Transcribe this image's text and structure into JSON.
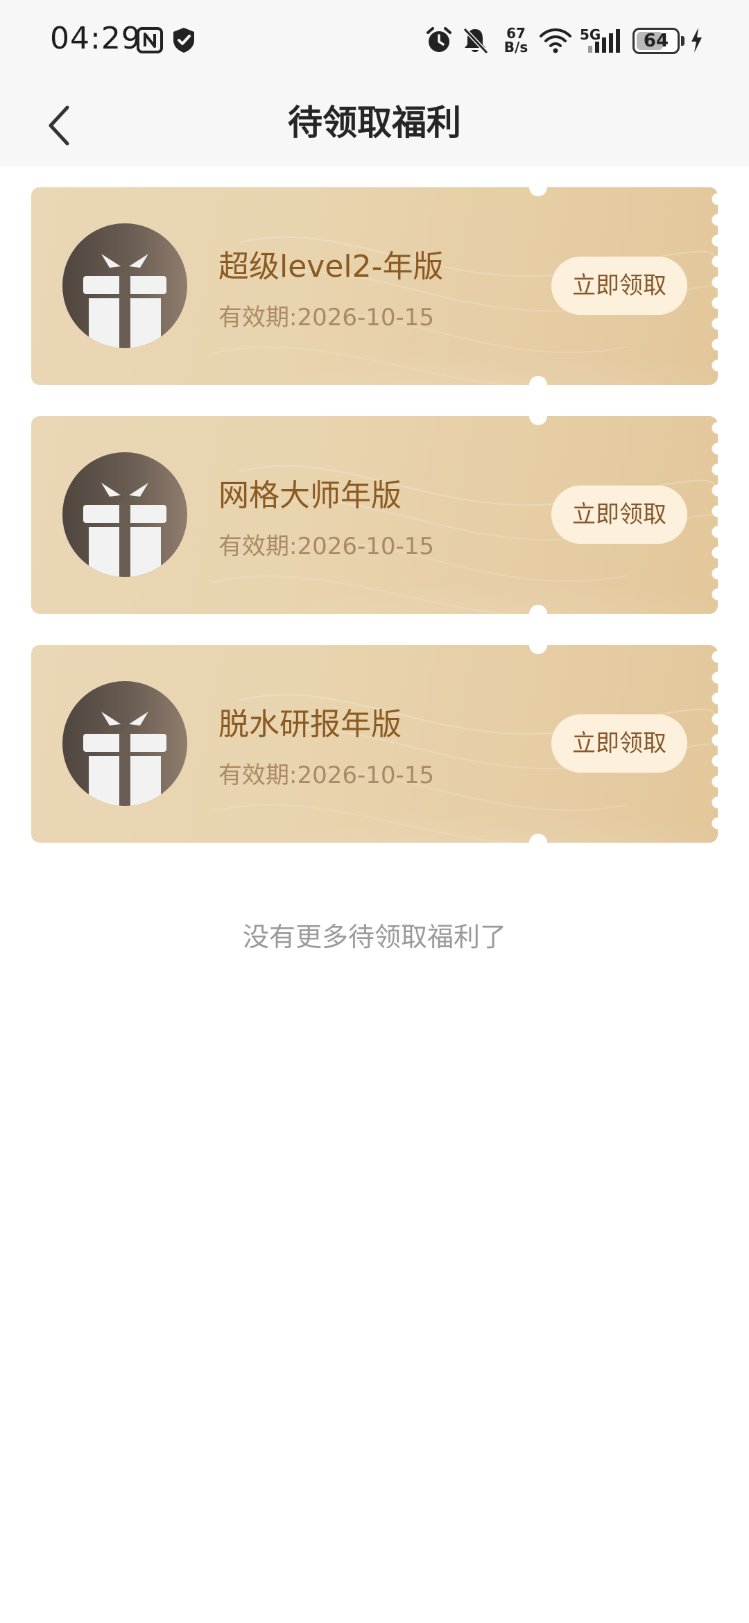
{
  "status_bar": {
    "time": "04:29",
    "net_speed_value": "67",
    "net_speed_unit": "B/s",
    "network_type": "5G",
    "battery_level": "64",
    "icons": [
      "nfc-icon",
      "shield-check-icon",
      "alarm-icon",
      "bell-off-icon",
      "wifi-icon",
      "signal-icon",
      "charging-icon"
    ]
  },
  "nav": {
    "title": "待领取福利",
    "back_icon": "chevron-left-icon"
  },
  "coupons": [
    {
      "title": "超级level2-年版",
      "expiry": "有效期:2026-10-15",
      "button": "立即领取"
    },
    {
      "title": "网格大师年版",
      "expiry": "有效期:2026-10-15",
      "button": "立即领取"
    },
    {
      "title": "脱水研报年版",
      "expiry": "有效期:2026-10-15",
      "button": "立即领取"
    }
  ],
  "footer": {
    "end_text": "没有更多待领取福利了"
  },
  "colors": {
    "card_gold": "#e8d3ad",
    "title_brown": "#8a5a22",
    "button_bg": "#fdf1de"
  }
}
